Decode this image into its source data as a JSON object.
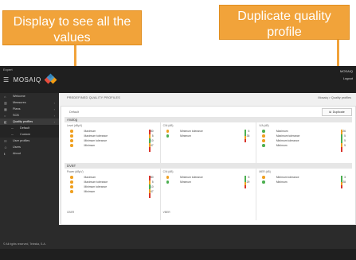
{
  "callouts": {
    "left": "Display to see all the values",
    "right": "Duplicate quality profile"
  },
  "topbar": {
    "user": "Expert",
    "app_name": "MOSAIQ",
    "right_line1": "MOSAIQ",
    "right_line2": "Logout"
  },
  "sidebar": {
    "items": [
      {
        "label": "Welcome",
        "icon": "home-icon"
      },
      {
        "label": "Measures",
        "icon": "chart-icon"
      },
      {
        "label": "Plans",
        "icon": "calendar-icon"
      },
      {
        "label": "SCB",
        "icon": "circle-icon"
      },
      {
        "label": "Quality profiles",
        "icon": "profile-icon"
      },
      {
        "label": "Default",
        "icon": "dash-icon"
      },
      {
        "label": "Custom",
        "icon": "dash-icon"
      },
      {
        "label": "User profiles",
        "icon": "users-icon"
      },
      {
        "label": "Users",
        "icon": "user-icon"
      },
      {
        "label": "About",
        "icon": "info-icon"
      }
    ],
    "footer": "© All rights reserved, Telestia, S.A."
  },
  "main": {
    "breadcrumb": "PREDEFINED QUALITY PROFILES",
    "breadcrumb_right": "Mosaiq > Quality profiles",
    "panel_title": "Default",
    "duplicate_label": "Duplicate"
  },
  "groups": [
    {
      "name": "Analog",
      "columns": [
        {
          "title": "Level (dBµV)",
          "rows": [
            {
              "label": "Maximum",
              "value": "80",
              "color": "#f0a020"
            },
            {
              "label": "Maximum tolerance",
              "value": "5",
              "color": "#f0a020"
            },
            {
              "label": "Minimum tolerance",
              "value": "10",
              "color": "#f0a020"
            },
            {
              "label": "Minimum",
              "value": "47",
              "color": "#f0a020"
            }
          ],
          "gauge": [
            "#d9342b",
            "#f0a020",
            "#4caf50",
            "#f0a020",
            "#d9342b"
          ]
        },
        {
          "title": "C/N (dB)",
          "rows": [
            {
              "label": "Minimum tolerance",
              "value": "6",
              "color": "#f0a020"
            },
            {
              "label": "Minimum",
              "value": "35",
              "color": "#4caf50"
            }
          ],
          "gauge": [
            "#4caf50",
            "#4caf50",
            "#f0a020",
            "#d9342b"
          ]
        },
        {
          "title": "V/A (dB)",
          "rows": [
            {
              "label": "Maximum",
              "value": "26",
              "color": "#4caf50"
            },
            {
              "label": "Maximum tolerance",
              "value": "5",
              "color": "#f0a020"
            },
            {
              "label": "Minimum tolerance",
              "value": "5",
              "color": "#f0a020"
            },
            {
              "label": "Minimum",
              "value": "5",
              "color": "#4caf50"
            }
          ],
          "gauge": [
            "#f0a020",
            "#4caf50",
            "#4caf50",
            "#f0a020",
            "#d9342b"
          ]
        }
      ]
    },
    {
      "name": "DVBT",
      "columns": [
        {
          "title": "Power (dBµV)",
          "rows": [
            {
              "label": "Maximum",
              "value": "80",
              "color": "#f0a020"
            },
            {
              "label": "Maximum tolerance",
              "value": "5",
              "color": "#f0a020"
            },
            {
              "label": "Minimum tolerance",
              "value": "10",
              "color": "#f0a020"
            },
            {
              "label": "Minimum",
              "value": "47",
              "color": "#f0a020"
            }
          ],
          "gauge": [
            "#d9342b",
            "#f0a020",
            "#4caf50",
            "#f0a020",
            "#d9342b"
          ]
        },
        {
          "title": "C/N (dB)",
          "rows": [
            {
              "label": "Minimum tolerance",
              "value": "5",
              "color": "#f0a020"
            },
            {
              "label": "Minimum",
              "value": "29",
              "color": "#4caf50"
            }
          ],
          "gauge": [
            "#4caf50",
            "#4caf50",
            "#f0a020",
            "#d9342b"
          ]
        },
        {
          "title": "MER (dB)",
          "rows": [
            {
              "label": "Minimum tolerance",
              "value": "3",
              "color": "#f0a020"
            },
            {
              "label": "Minimum",
              "value": "28",
              "color": "#4caf50"
            }
          ],
          "gauge": [
            "#4caf50",
            "#4caf50",
            "#f0a020",
            "#d9342b"
          ]
        }
      ]
    },
    {
      "name": "",
      "columns": [
        {
          "title": "CBER",
          "rows": [],
          "gauge": []
        },
        {
          "title": "VBER",
          "rows": [],
          "gauge": []
        },
        {
          "title": "",
          "rows": [],
          "gauge": []
        }
      ]
    }
  ]
}
